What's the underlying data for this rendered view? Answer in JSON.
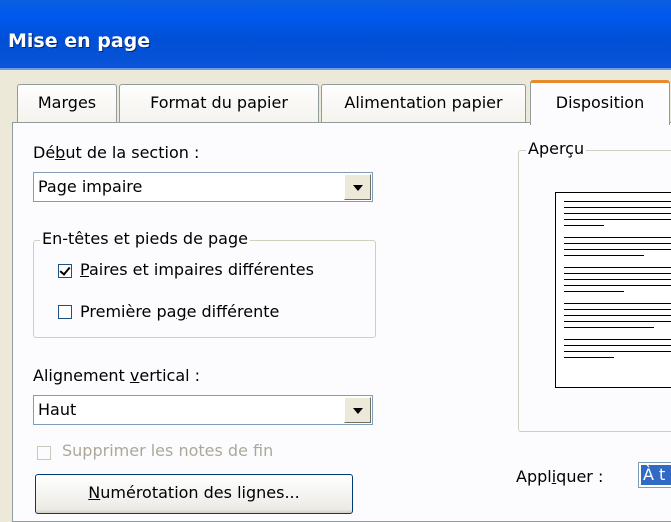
{
  "window": {
    "title": "Mise en page"
  },
  "tabs": [
    {
      "label": "Marges"
    },
    {
      "label": "Format du papier"
    },
    {
      "label": "Alimentation papier"
    },
    {
      "label": "Disposition",
      "active": true
    }
  ],
  "section_start": {
    "label_pre": "Dé",
    "label_accel": "b",
    "label_post": "ut de la section :",
    "value": "Page impaire"
  },
  "headers_footers": {
    "legend": "En-têtes et pieds de page",
    "odd_even": {
      "accel": "P",
      "rest": "aires et impaires différentes",
      "checked": true
    },
    "first_page": {
      "pre": "Première pa",
      "accel": "g",
      "post": "e différente",
      "checked": false
    }
  },
  "vertical_alignment": {
    "label_pre": "Alignement ",
    "label_accel": "v",
    "label_post": "ertical :",
    "value": "Haut"
  },
  "suppress_endnotes": {
    "label": "Supprimer les notes de fin",
    "checked": false,
    "enabled": false
  },
  "line_numbers_button": {
    "accel": "N",
    "rest": "umérotation des lignes..."
  },
  "preview": {
    "legend": "Aperçu"
  },
  "apply": {
    "label_pre": "Appl",
    "label_accel": "i",
    "label_post": "quer :",
    "value": "À t"
  }
}
